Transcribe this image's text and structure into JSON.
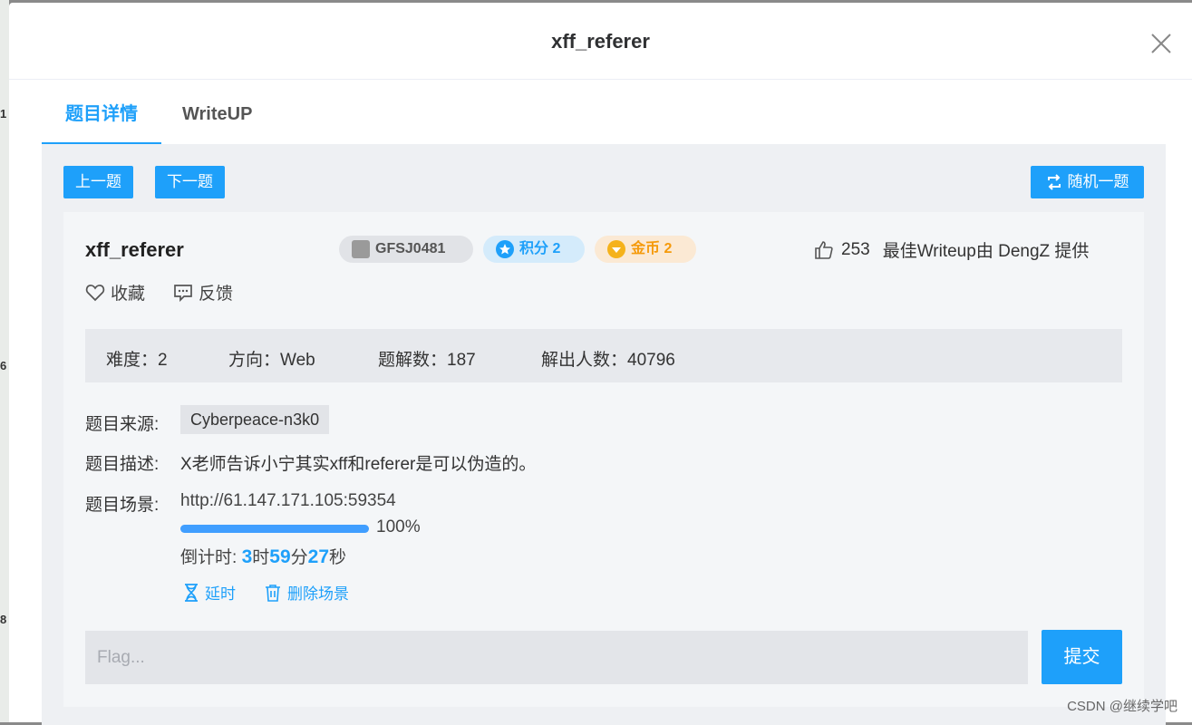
{
  "background": {
    "row_numbers": [
      "1",
      "6",
      "8"
    ]
  },
  "modal": {
    "title": "xff_referer",
    "close_icon": "close-icon"
  },
  "tabs": [
    {
      "label": "题目详情",
      "active": true
    },
    {
      "label": "WriteUP",
      "active": false
    }
  ],
  "nav": {
    "prev_label": "上一题",
    "next_label": "下一题",
    "random_label": "随机一题",
    "random_icon": "shuffle-icon"
  },
  "challenge": {
    "name": "xff_referer",
    "id_badge": "GFSJ0481",
    "score_badge": "积分 2",
    "coin_badge": "金币 2",
    "likes": "253",
    "best_writeup": "最佳Writeup由 DengZ 提供",
    "favorite_label": "收藏",
    "feedback_label": "反馈"
  },
  "info": {
    "difficulty": "难度：2",
    "direction": "方向：Web",
    "writeups": "题解数：187",
    "solvers": "解出人数：40796"
  },
  "details": {
    "source_label": "题目来源:",
    "source_value": "Cyberpeace-n3k0",
    "desc_label": "题目描述:",
    "desc_value": "X老师告诉小宁其实xff和referer是可以伪造的。",
    "scene_label": "题目场景:",
    "scene_url": "http://61.147.171.105:59354",
    "progress_percent": 100,
    "progress_text": "100%",
    "countdown_prefix": "倒计时: ",
    "countdown_hours": "3",
    "countdown_h_unit": "时",
    "countdown_minutes": "59",
    "countdown_m_unit": "分",
    "countdown_seconds": "27",
    "countdown_s_unit": "秒",
    "extend_label": "延时",
    "delete_label": "删除场景"
  },
  "flag": {
    "placeholder": "Flag...",
    "value": "",
    "submit_label": "提交"
  },
  "watermark": "CSDN @继续学吧",
  "colors": {
    "accent": "#1ea0fa",
    "progress": "#409eff",
    "coin": "#f59a0b"
  }
}
